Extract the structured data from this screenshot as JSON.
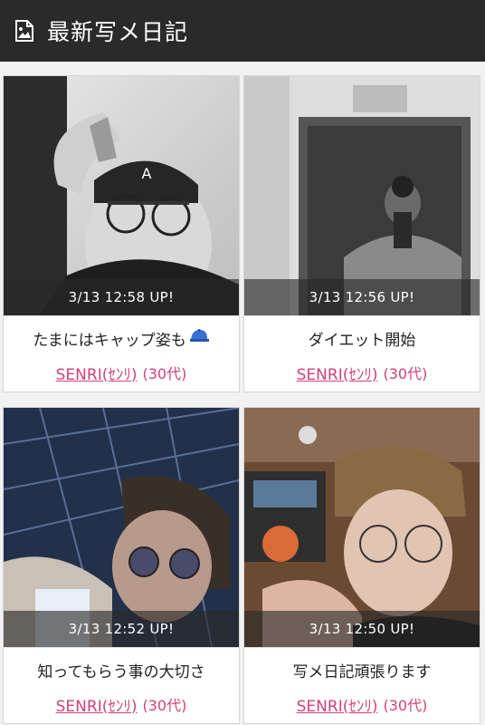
{
  "header": {
    "title": "最新写メ日記",
    "icon": "image-icon"
  },
  "posts": [
    {
      "time": "3/13 12:58 UP!",
      "title": "たまにはキャップ姿も",
      "title_emoji": "cap-icon",
      "author": "SENRI(ｾﾝﾘ)",
      "age": "(30代)"
    },
    {
      "time": "3/13 12:56 UP!",
      "title": "ダイエット開始",
      "author": "SENRI(ｾﾝﾘ)",
      "age": "(30代)"
    },
    {
      "time": "3/13 12:52 UP!",
      "title": "知ってもらう事の大切さ",
      "author": "SENRI(ｾﾝﾘ)",
      "age": "(30代)"
    },
    {
      "time": "3/13 12:50 UP!",
      "title": "写メ日記頑張ります",
      "author": "SENRI(ｾﾝﾘ)",
      "age": "(30代)"
    }
  ],
  "colors": {
    "header_bg": "#2a2a2a",
    "author_link": "#d0427a"
  }
}
